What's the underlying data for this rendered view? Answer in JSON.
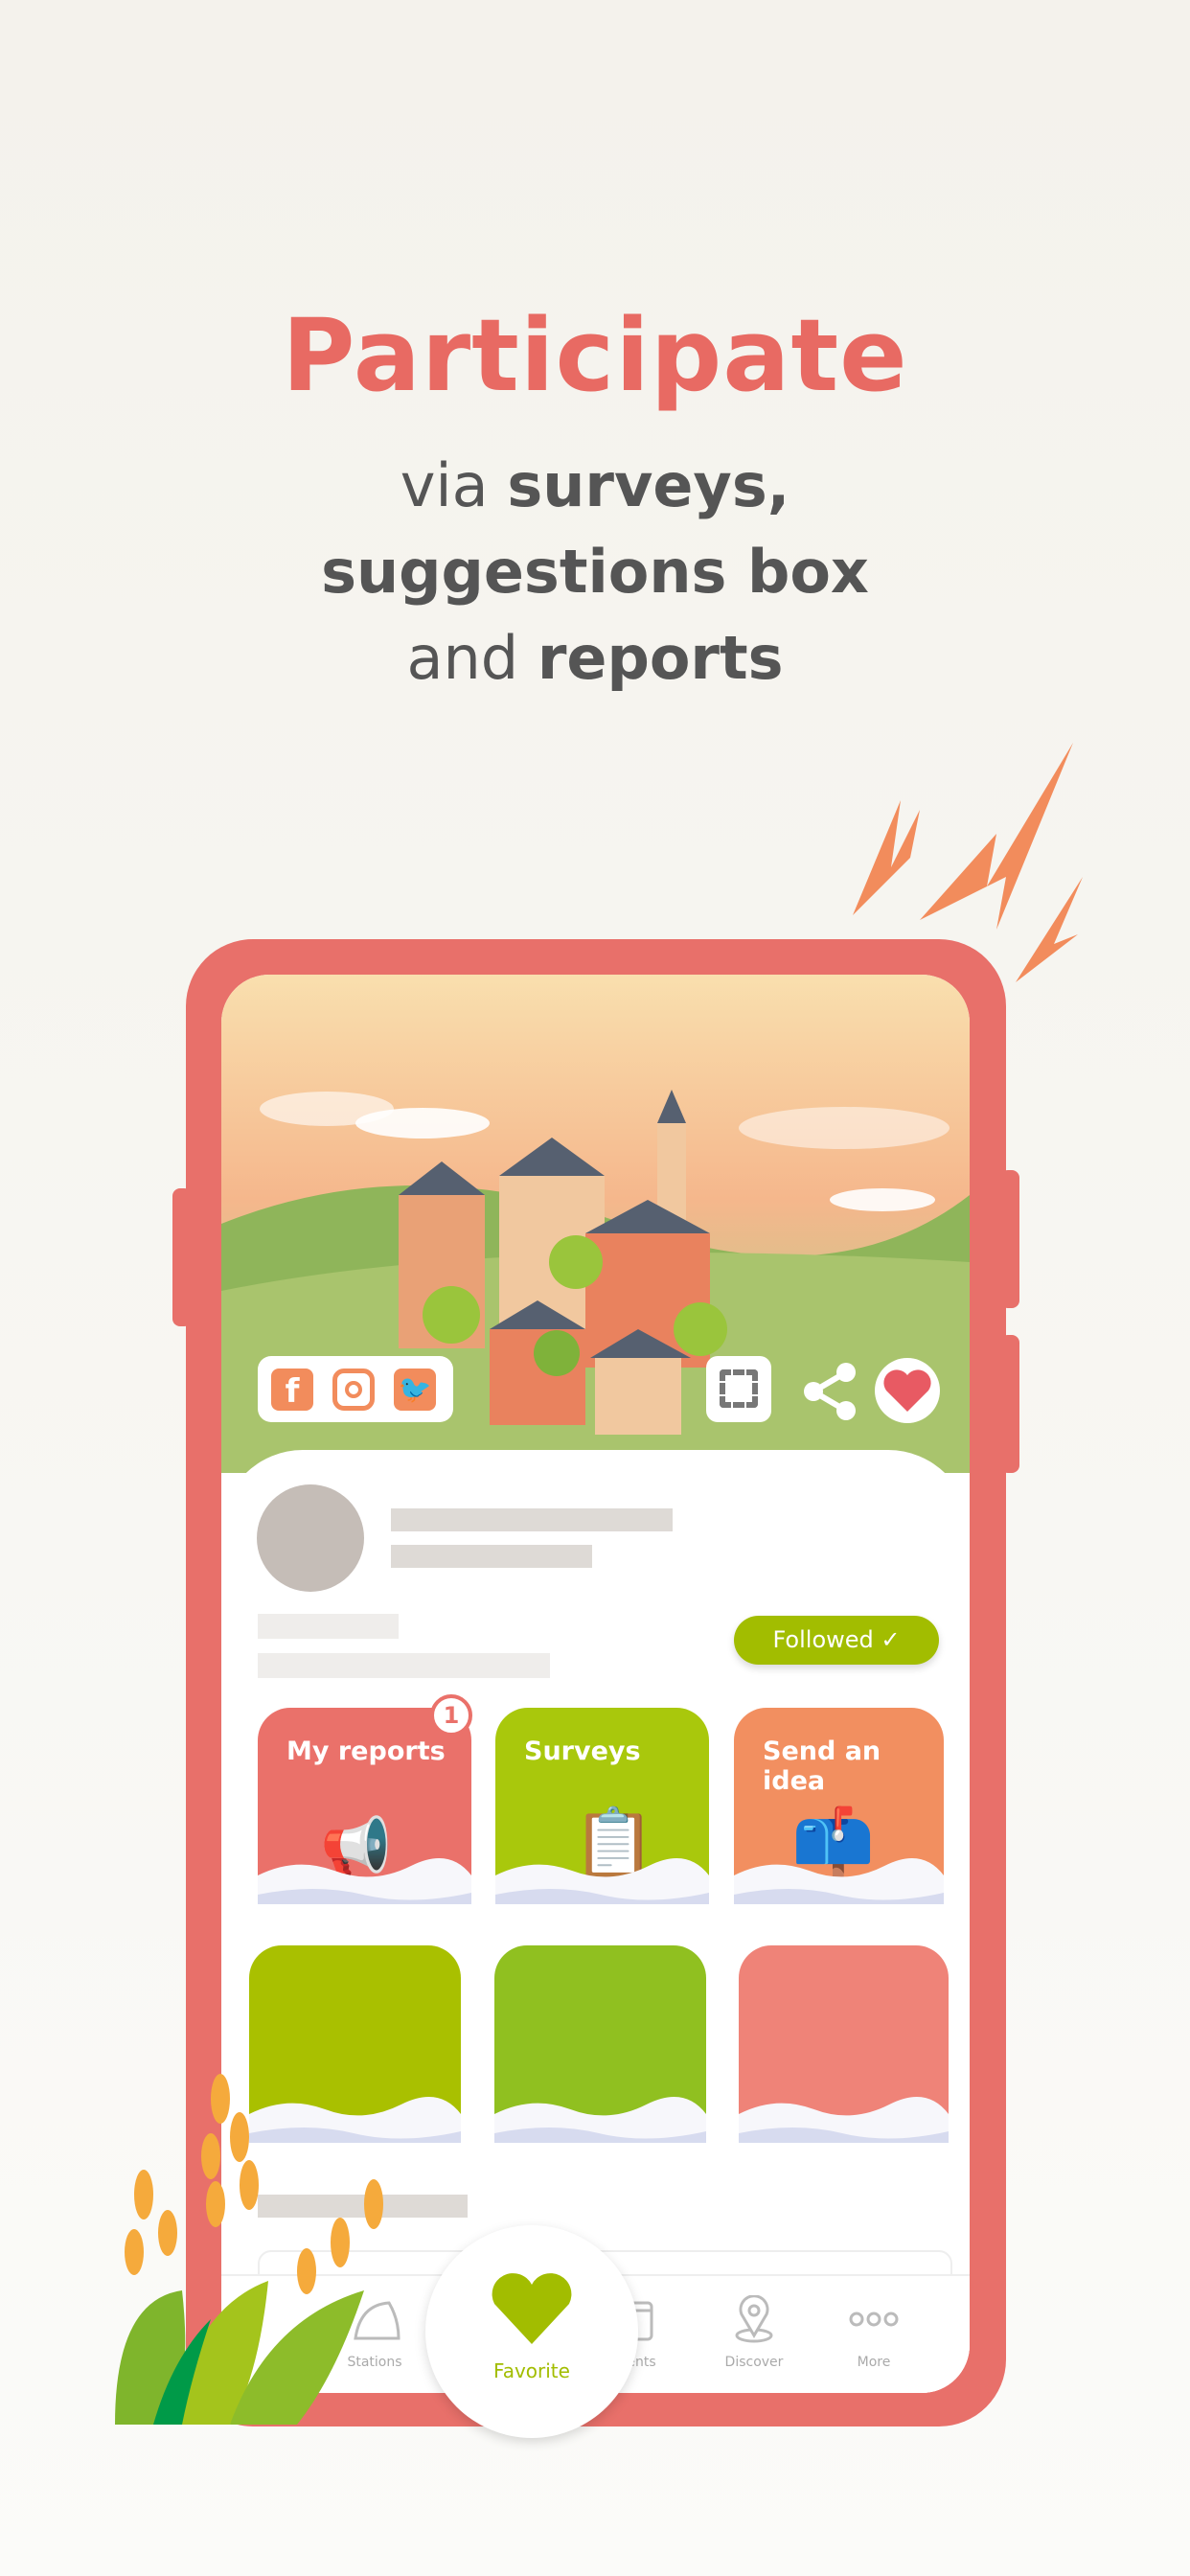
{
  "headline": {
    "title": "Participate",
    "line1_pre": "via ",
    "line1_bold": "surveys,",
    "line2_bold": "suggestions box",
    "line3_pre": "and ",
    "line3_bold": "reports"
  },
  "colors": {
    "accent": "#e86a63",
    "green": "#a2bd00",
    "orange": "#f28c5c"
  },
  "social": [
    "facebook-icon",
    "instagram-icon",
    "twitter-icon"
  ],
  "actions": [
    "qr-code-icon",
    "share-icon",
    "heart-icon"
  ],
  "profile": {
    "follow_label": "Followed",
    "follow_icon": "check-icon"
  },
  "tiles": [
    {
      "label": "My reports",
      "badge": "1",
      "color": "#ea716a"
    },
    {
      "label": "Surveys",
      "color": "#a9c80c"
    },
    {
      "label": "Send an idea",
      "color": "#f28f60"
    }
  ],
  "nav": {
    "items": [
      {
        "label": "Stations"
      },
      {
        "label": "Favorite"
      },
      {
        "label": "Events"
      },
      {
        "label": "Discover"
      },
      {
        "label": "More"
      }
    ],
    "active": "Favorite"
  }
}
